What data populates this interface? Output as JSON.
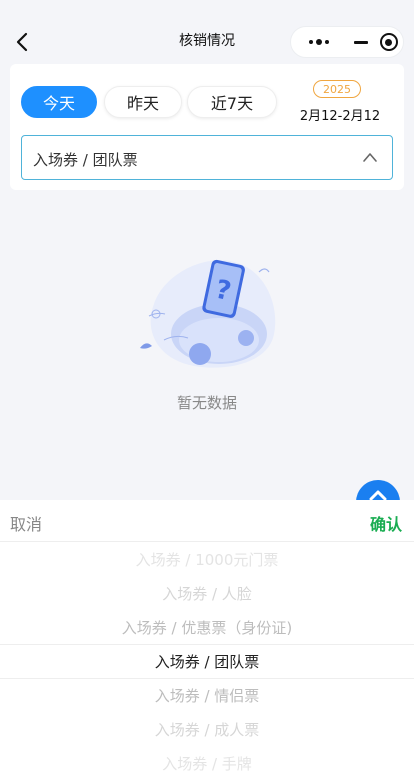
{
  "nav": {
    "title": "核销情况",
    "back_icon": "chevron-left-icon",
    "more_icon": "more-dots-icon",
    "minimize_icon": "minus-icon",
    "close_icon": "target-circle-icon"
  },
  "filter": {
    "days": [
      {
        "label": "今天",
        "active": true
      },
      {
        "label": "昨天",
        "active": false
      },
      {
        "label": "近7天",
        "active": false
      }
    ],
    "year": "2025",
    "date_range": "2月12-2月12",
    "select_value": "入场券 / 团队票",
    "select_icon": "chevron-up-icon"
  },
  "empty": {
    "illustration": "empty-phone-question-illustration",
    "text": "暂无数据"
  },
  "fab_icon": "chevron-up-icon",
  "picker": {
    "cancel_label": "取消",
    "confirm_label": "确认",
    "options": [
      "入场券 / 1000元门票",
      "入场券 / 人脸",
      "入场券 / 优惠票（身份证)",
      "入场券 / 团队票",
      "入场券 / 情侣票",
      "入场券 / 成人票",
      "入场券 / 手牌"
    ],
    "selected_index": 3
  },
  "colors": {
    "accent": "#1e90ff",
    "confirm": "#1aad52",
    "year_badge": "#f0a640",
    "select_border": "#4fb3d9"
  }
}
